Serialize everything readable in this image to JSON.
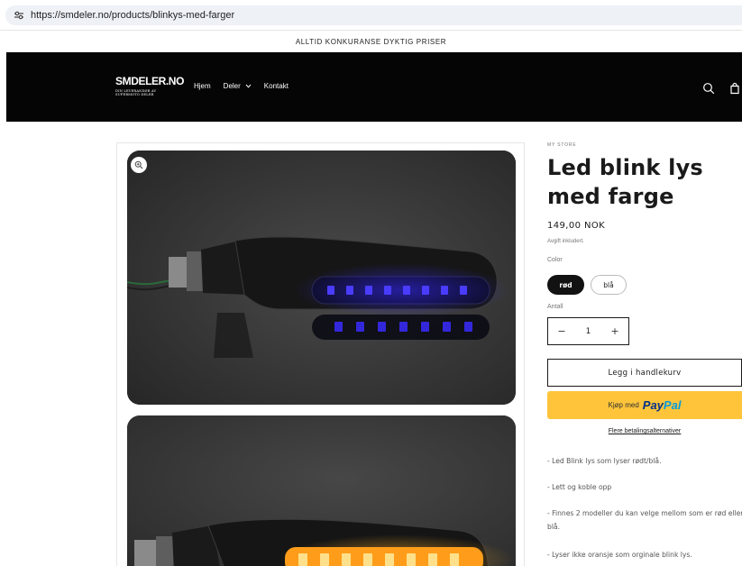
{
  "browser": {
    "url": "https://smdeler.no/products/blinkys-med-farger",
    "site_info_icon": "tune-icon"
  },
  "announcement": "ALLTID KONKURANSE DYKTIG PRISER",
  "header": {
    "logo_title": "SMDELER.NO",
    "logo_sub_1": "DIN LEVERANDØR AV",
    "logo_sub_2": "SUPERMOTO DELER",
    "nav": [
      {
        "label": "Hjem"
      },
      {
        "label": "Deler"
      },
      {
        "label": "Kontakt"
      }
    ],
    "icons": [
      "search-icon",
      "cart-icon"
    ],
    "background": "#050505"
  },
  "gallery": {
    "zoom_icon": "zoom-icon",
    "images": [
      {
        "subject": "led-turn-signal-blue"
      },
      {
        "subject": "led-turn-signal-amber"
      }
    ]
  },
  "product": {
    "vendor": "MY STORE",
    "title": "Led blink lys med farge",
    "price": "149,00 NOK",
    "tax_note": "Avgift inkludert.",
    "color_label": "Color",
    "colors": [
      {
        "label": "rød",
        "selected": true
      },
      {
        "label": "blå",
        "selected": false
      }
    ],
    "quantity_label": "Antall",
    "quantity": "1",
    "minus": "−",
    "plus": "+",
    "add_to_cart": "Legg i handlekurv",
    "paypal_lead": "Kjøp med",
    "paypal_a": "Pay",
    "paypal_b": "Pal",
    "more_payment": "Flere betalingsalternativer",
    "description": [
      "- Led Blink lys som lyser rødt/blå.",
      "- Lett og koble opp",
      "- Finnes 2 modeller du kan velge mellom som er rød eller blå.",
      "- Lyser ikke oransje som orginale  blink lys."
    ]
  },
  "colors": {
    "paypal_yellow": "#ffc43a",
    "paypal_dark": "#003087",
    "paypal_light": "#009cde",
    "selected_pill": "#121212",
    "led_blue": "#3a2cff",
    "led_amber": "#ffb020"
  }
}
